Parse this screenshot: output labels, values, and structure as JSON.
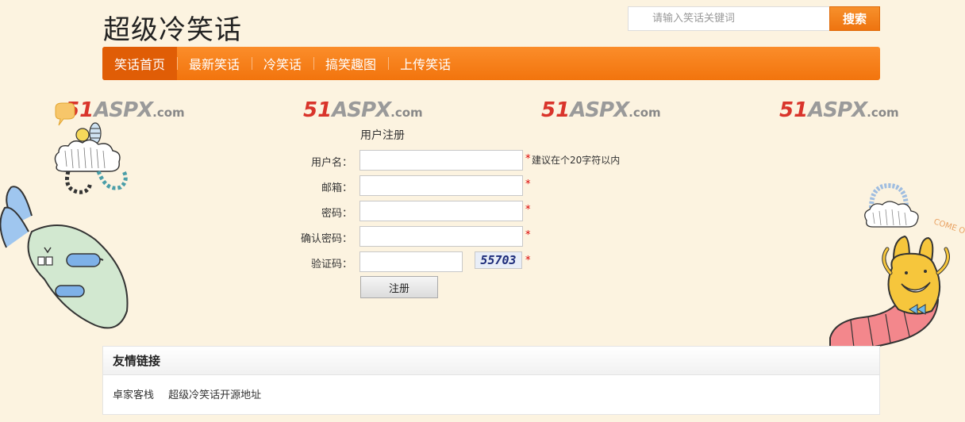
{
  "header": {
    "site_title": "超级冷笑话",
    "search_placeholder": "请输入笑话关键词",
    "search_button": "搜索"
  },
  "nav": {
    "items": [
      {
        "label": "笑话首页",
        "active": true
      },
      {
        "label": "最新笑话"
      },
      {
        "label": "冷笑话"
      },
      {
        "label": "搞笑趣图"
      },
      {
        "label": "上传笑话"
      }
    ]
  },
  "watermark": {
    "num": "51",
    "aspx": "ASPX",
    "com": ".com"
  },
  "decor": {
    "come_text": "COME O"
  },
  "form": {
    "title": "用户注册",
    "username_label": "用户名：",
    "email_label": "邮箱：",
    "password_label": "密码：",
    "confirm_label": "确认密码：",
    "captcha_label": "验证码：",
    "required_mark": "*",
    "username_hint": "建议在个20字符以内",
    "captcha_text": "55703",
    "submit_label": "注册"
  },
  "links": {
    "title": "友情链接",
    "items": [
      "卓家客栈",
      "超级冷笑话开源地址"
    ]
  },
  "colors": {
    "background": "#fcf3e0",
    "nav_orange": "#f2740d",
    "nav_active": "#e05d06",
    "required_red": "#dd0000"
  }
}
